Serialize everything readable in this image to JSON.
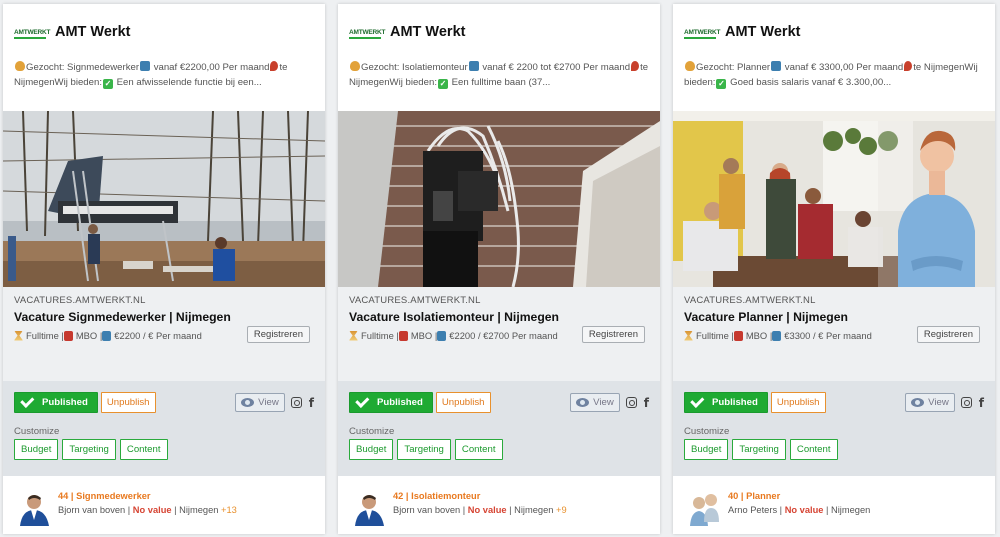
{
  "cards": [
    {
      "logo_text": "AMTWERKT",
      "brand": "AMT Werkt",
      "desc": {
        "p1": "Gezocht: Signmedewerker",
        "p2": " vanaf €2200,00 Per maand",
        "p3": "te NijmegenWij bieden:",
        "p4": " Een afwisselende functie bij een..."
      },
      "site": "VACATURES.AMTWERKT.NL",
      "title": "Vacature Signmedewerker | Nijmegen",
      "meta": {
        "m1": "Fulltime | ",
        "m2": " MBO | ",
        "m3": " €2200 / € Per maand"
      },
      "register": "Registreren",
      "published": "Published",
      "unpublish": "Unpublish",
      "view": "View",
      "customize": "Customize",
      "options": [
        "Budget",
        "Targeting",
        "Content"
      ],
      "footer": {
        "count": "44",
        "sep": " | ",
        "job": "Signmedewerker",
        "person": "Bjorn van boven",
        "novalue": "No value",
        "city": "Nijmegen",
        "plus": "+13"
      },
      "icons": {
        "hand": "hand-icon",
        "chart": "chart-icon",
        "pin": "pin-icon",
        "check": "check-icon",
        "hourglass": "hourglass-icon",
        "book": "book-icon"
      }
    },
    {
      "logo_text": "AMTWERKT",
      "brand": "AMT Werkt",
      "desc": {
        "p1": "Gezocht: Isolatiemonteur",
        "p2": " vanaf € 2200 tot €2700 Per maand",
        "p3": "te NijmegenWij bieden:",
        "p4": " Een fulltime baan (37..."
      },
      "site": "VACATURES.AMTWERKT.NL",
      "title": "Vacature Isolatiemonteur | Nijmegen",
      "meta": {
        "m1": "Fulltime | ",
        "m2": " MBO | ",
        "m3": " €2200 / €2700 Per maand"
      },
      "register": "Registreren",
      "published": "Published",
      "unpublish": "Unpublish",
      "view": "View",
      "customize": "Customize",
      "options": [
        "Budget",
        "Targeting",
        "Content"
      ],
      "footer": {
        "count": "42",
        "sep": " | ",
        "job": "Isolatiemonteur",
        "person": "Bjorn van boven",
        "novalue": "No value",
        "city": "Nijmegen",
        "plus": "+9"
      }
    },
    {
      "logo_text": "AMTWERKT",
      "brand": "AMT Werkt",
      "desc": {
        "p1": "Gezocht: Planner",
        "p2": " vanaf € 3300,00 Per maand",
        "p3": "te NijmegenWij bieden:",
        "p4": " Goed basis salaris vanaf € 3.300,00..."
      },
      "site": "VACATURES.AMTWERKT.NL",
      "title": "Vacature Planner | Nijmegen",
      "meta": {
        "m1": "Fulltime | ",
        "m2": " MBO | ",
        "m3": " €3300 / € Per maand"
      },
      "register": "Registreren",
      "published": "Published",
      "unpublish": "Unpublish",
      "view": "View",
      "customize": "Customize",
      "options": [
        "Budget",
        "Targeting",
        "Content"
      ],
      "footer": {
        "count": "40",
        "sep": " | ",
        "job": "Planner",
        "person": "Arno Peters",
        "novalue": "No value",
        "city": "Nijmegen",
        "plus": ""
      }
    }
  ],
  "colors": {
    "published": "#1faa33",
    "unpublish": "#e8912e",
    "footer_accent": "#e8791f",
    "no_value": "#d64433"
  }
}
